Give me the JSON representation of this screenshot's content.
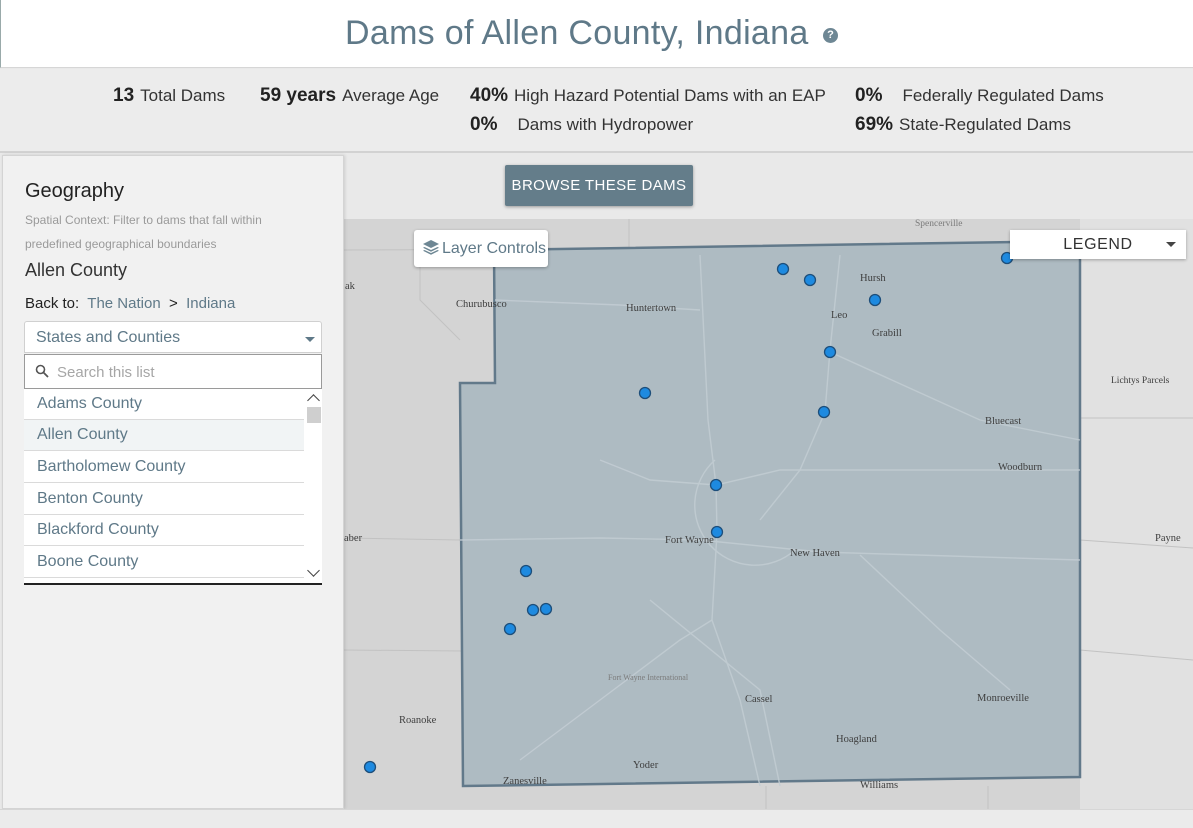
{
  "header": {
    "title": "Dams of Allen County, Indiana",
    "help_icon": "help-circle-icon"
  },
  "stats": [
    {
      "value": "13",
      "label": "Total Dams"
    },
    {
      "value": "59 years",
      "label": "Average Age"
    },
    {
      "value": "40%",
      "label": "High Hazard Potential Dams with an EAP"
    },
    {
      "value": "0%",
      "label": "Dams with Hydropower"
    },
    {
      "value": "0%",
      "label": "Federally Regulated Dams"
    },
    {
      "value": "69%",
      "label": "State-Regulated Dams"
    }
  ],
  "toolbar": {
    "browse_label": "BROWSE THESE DAMS"
  },
  "map": {
    "layer_controls_label": "Layer Controls",
    "legend_label": "LEGEND",
    "accent_color": "#1e8ae0",
    "county_fill": "#aab8c0",
    "place_labels": [
      "Spencerville",
      "Hursh",
      "Leo",
      "Grabill",
      "Churubusco",
      "Huntertown",
      "Bluecast",
      "Woodburn",
      "Lichtys Parcels",
      "Payne",
      "Fort Wayne",
      "New Haven",
      "Fort Wayne International",
      "Cassel",
      "Monroeville",
      "Roanoke",
      "Hoagland",
      "Yoder",
      "Zanesville",
      "Williams",
      "ak",
      "aber"
    ]
  },
  "panel": {
    "title": "Geography",
    "subtitle": "Spatial Context: Filter to dams that fall within predefined geographical boundaries",
    "current": "Allen County",
    "back_to": "Back to:",
    "crumbs": [
      "The Nation",
      "Indiana"
    ],
    "separator": ">",
    "select_value": "States and Counties",
    "search_placeholder": "Search this list",
    "items": [
      "Adams County",
      "Allen County",
      "Bartholomew County",
      "Benton County",
      "Blackford County",
      "Boone County"
    ],
    "selected_item": "Allen County"
  }
}
